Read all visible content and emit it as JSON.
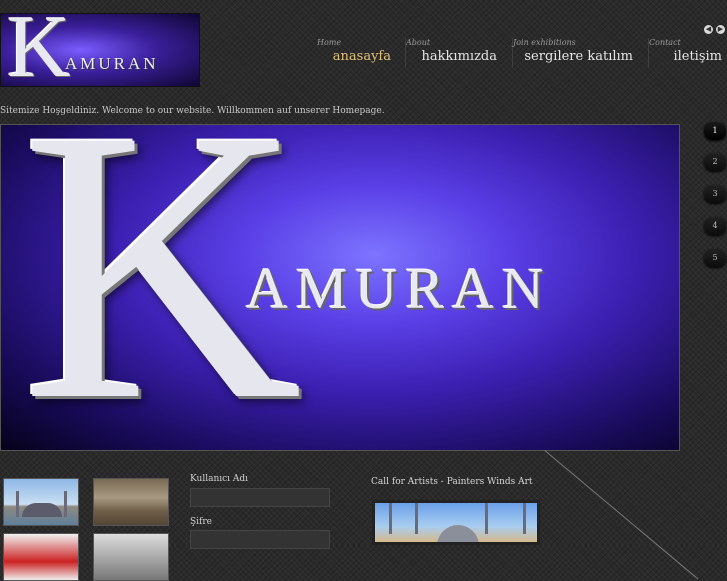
{
  "logo": {
    "letter": "K",
    "word": "AMURAN"
  },
  "nav": {
    "arrows": [
      "◀",
      "▶"
    ],
    "items": [
      {
        "sub": "Home",
        "label": "anasayfa",
        "active": true
      },
      {
        "sub": "About",
        "label": "hakkımızda"
      },
      {
        "sub": "Join exhibitions",
        "label": "sergilere katılım"
      },
      {
        "sub": "Contact",
        "label": "iletişim"
      }
    ]
  },
  "welcome": "Sitemize Hoşgeldiniz. Welcome to our website. Willkommen auf unserer Homepage.",
  "banner": {
    "letter": "K",
    "word": "AMURAN"
  },
  "slides": [
    "1",
    "2",
    "3",
    "4",
    "5"
  ],
  "login": {
    "username_label": "Kullanıcı Adı",
    "password_label": "Şifre"
  },
  "call": {
    "title": "Call for Artists - Painters Winds Art"
  }
}
